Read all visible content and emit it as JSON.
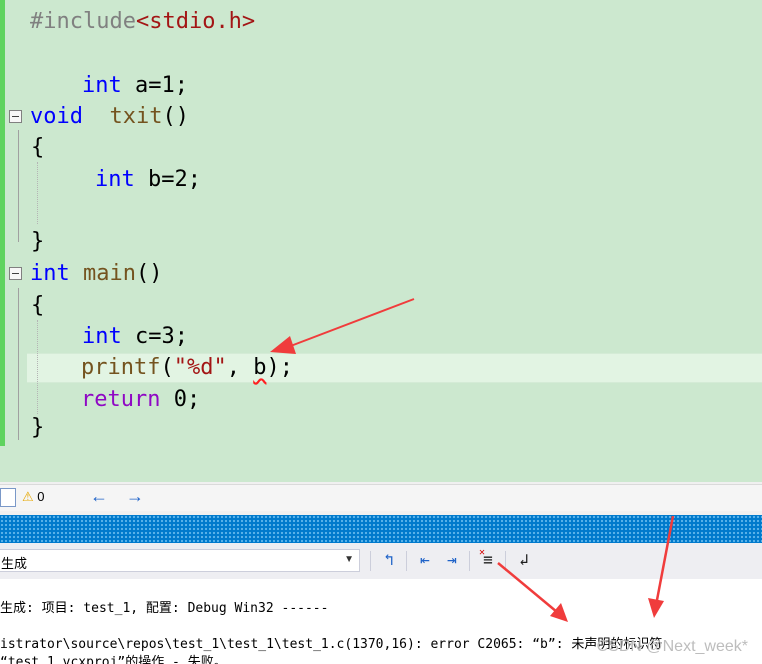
{
  "editor": {
    "include": {
      "directive": "#include",
      "header": "<stdio.h>"
    },
    "global_decl": {
      "type": "int",
      "rest": " a=1;"
    },
    "func1": {
      "ret": "void",
      "name": "txit",
      "parens": "()"
    },
    "open_brace": "{",
    "local_b": {
      "type": "int",
      "rest": " b=2;"
    },
    "close_brace": "}",
    "main": {
      "ret": "int",
      "name": "main",
      "parens": "()"
    },
    "decl_c": {
      "type": "int",
      "rest": " c=3;"
    },
    "printf": {
      "fn": "printf",
      "open": "(",
      "str": "\"%d\"",
      "sep": ", ",
      "arg": "b",
      "close": ");"
    },
    "ret": {
      "kw": "return",
      "rest": " 0;"
    }
  },
  "status": {
    "warning_count": "0",
    "back_icon": "arrow-left-icon",
    "forward_icon": "arrow-right-icon"
  },
  "output_panel": {
    "source_value": "生成",
    "lines": [
      "生成: 项目: test_1, 配置: Debug Win32 ------",
      "istrator\\source\\repos\\test_1\\test_1\\test_1.c(1370,16): error C2065: “b”: 未声明的标识符",
      "“test_1.vcxproj”的操作 - 失败。"
    ]
  },
  "watermark": "CSDN @Next_week*",
  "colors": {
    "editor_bg": "#cce8cf",
    "keyword": "#0000ff",
    "string": "#a31515",
    "arrow": "#f03c3c",
    "panel_header": "#007acc"
  }
}
